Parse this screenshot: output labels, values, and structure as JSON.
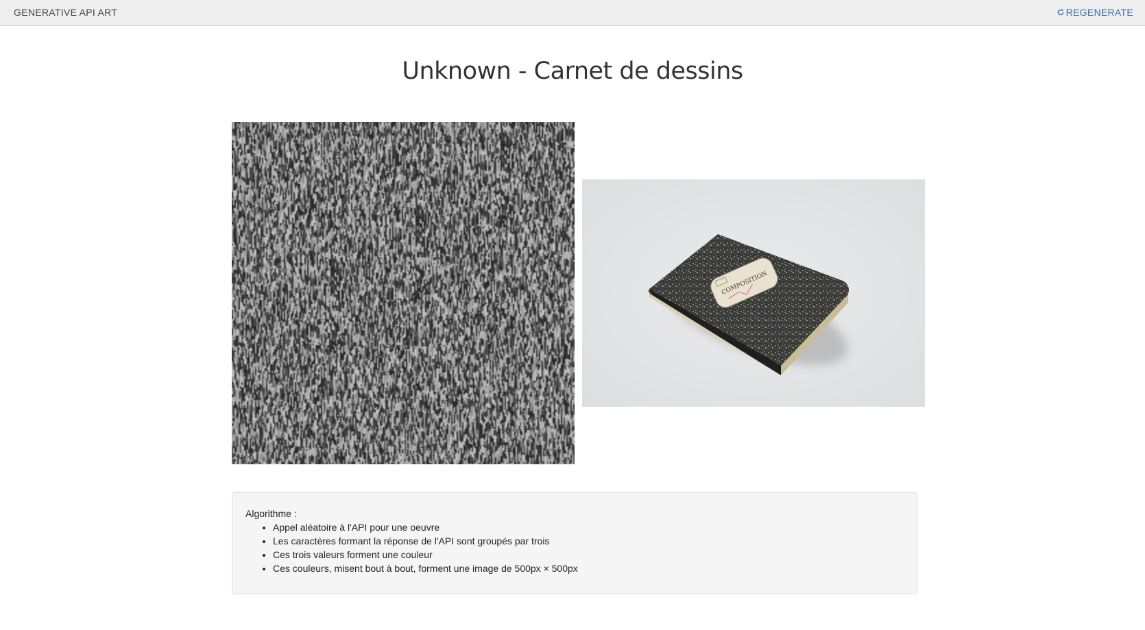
{
  "navbar": {
    "brand": "GENERATIVE API ART",
    "regenerate_label": "REGENERATE",
    "regenerate_icon": "refresh-icon",
    "link_color": "#3d6fa8"
  },
  "main": {
    "title": "Unknown - Carnet de dessins",
    "generated_image": {
      "description_icon": "noise-art-image",
      "palette": [
        "#2a2a2a",
        "#3c3c3c",
        "#555555",
        "#8e8e8e",
        "#a6a6a6",
        "#bdbdbd"
      ]
    },
    "source_image": {
      "label_on_cover": "COMPOSITION"
    }
  },
  "algorithm": {
    "heading": "Algorithme :",
    "steps": [
      "Appel aléatoire à l'API pour une oeuvre",
      "Les caractères formant la réponse de l'API sont groupés par trois",
      "Ces trois valeurs forment une couleur",
      "Ces couleurs, misent bout à bout, forment une image de 500px × 500px"
    ]
  }
}
